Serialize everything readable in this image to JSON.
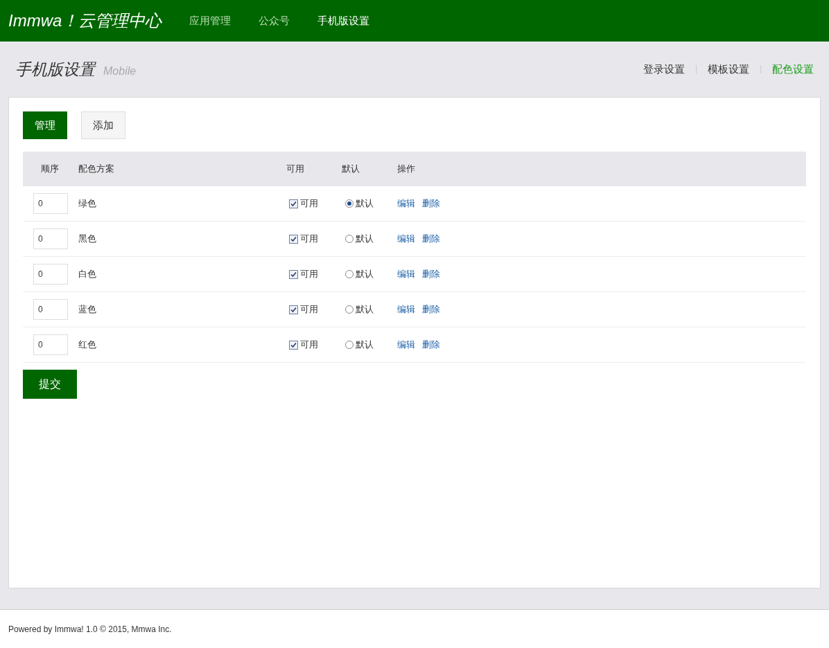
{
  "brand": "Immwa！云管理中心",
  "nav": [
    {
      "label": "应用管理",
      "selected": false
    },
    {
      "label": "公众号",
      "selected": false
    },
    {
      "label": "手机版设置",
      "selected": true
    }
  ],
  "page": {
    "title": "手机版设置",
    "subtitle": "Mobile"
  },
  "subnav": [
    {
      "label": "登录设置",
      "selected": false
    },
    {
      "label": "模板设置",
      "selected": false
    },
    {
      "label": "配色设置",
      "selected": true
    }
  ],
  "tabs": [
    {
      "label": "管理",
      "selected": true
    },
    {
      "label": "添加",
      "selected": false
    }
  ],
  "table": {
    "columns": [
      "顺序",
      "配色方案",
      "可用",
      "默认",
      "操作"
    ],
    "rows": [
      {
        "order": "0",
        "name": "绿色",
        "enabled_label": "可用",
        "enabled": true,
        "default_label": "默认",
        "default": true,
        "actions": [
          "编辑",
          "删除"
        ]
      },
      {
        "order": "0",
        "name": "黑色",
        "enabled_label": "可用",
        "enabled": true,
        "default_label": "默认",
        "default": false,
        "actions": [
          "编辑",
          "删除"
        ]
      },
      {
        "order": "0",
        "name": "白色",
        "enabled_label": "可用",
        "enabled": true,
        "default_label": "默认",
        "default": false,
        "actions": [
          "编辑",
          "删除"
        ]
      },
      {
        "order": "0",
        "name": "蓝色",
        "enabled_label": "可用",
        "enabled": true,
        "default_label": "默认",
        "default": false,
        "actions": [
          "编辑",
          "删除"
        ]
      },
      {
        "order": "0",
        "name": "红色",
        "enabled_label": "可用",
        "enabled": true,
        "default_label": "默认",
        "default": false,
        "actions": [
          "编辑",
          "删除"
        ]
      }
    ]
  },
  "submit": "提交",
  "footer": "Powered by Immwa! 1.0 © 2015, Mmwa Inc."
}
